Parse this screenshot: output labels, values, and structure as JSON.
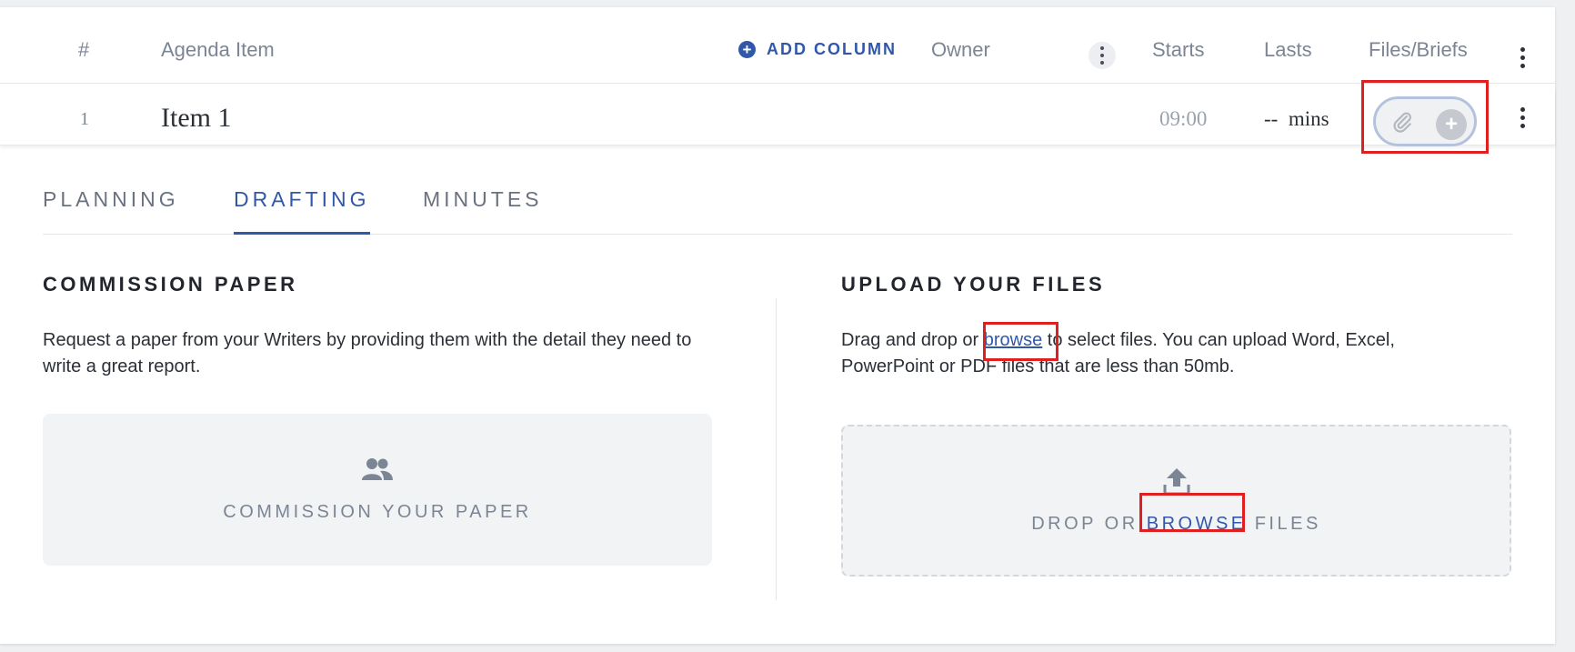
{
  "header": {
    "hash": "#",
    "agenda_item": "Agenda Item",
    "add_column": "ADD COLUMN",
    "owner": "Owner",
    "starts": "Starts",
    "lasts": "Lasts",
    "files_briefs": "Files/Briefs"
  },
  "item": {
    "number": "1",
    "title": "Item 1",
    "starts": "09:00",
    "lasts": "--  mins"
  },
  "tabs": [
    {
      "label": "PLANNING",
      "active": false
    },
    {
      "label": "DRAFTING",
      "active": true
    },
    {
      "label": "MINUTES",
      "active": false
    }
  ],
  "commission": {
    "title": "COMMISSION PAPER",
    "description": "Request a paper from your Writers by providing them with the detail they need to write a great report.",
    "button_label": "COMMISSION YOUR PAPER"
  },
  "upload": {
    "title": "UPLOAD YOUR FILES",
    "desc_prefix": "Drag and drop or ",
    "desc_link": "browse",
    "desc_suffix": " to select files. You can upload Word, Excel, PowerPoint or PDF files that are less than 50mb.",
    "drop_prefix": "DROP OR ",
    "drop_link": "BROWSE",
    "drop_suffix": " FILES"
  },
  "icons": {
    "add_column": "plus-circle-icon",
    "commission": "people-icon",
    "upload": "upload-icon",
    "attachment": "paperclip-icon"
  },
  "colors": {
    "accent": "#3158a8",
    "highlight": "#e02020"
  }
}
